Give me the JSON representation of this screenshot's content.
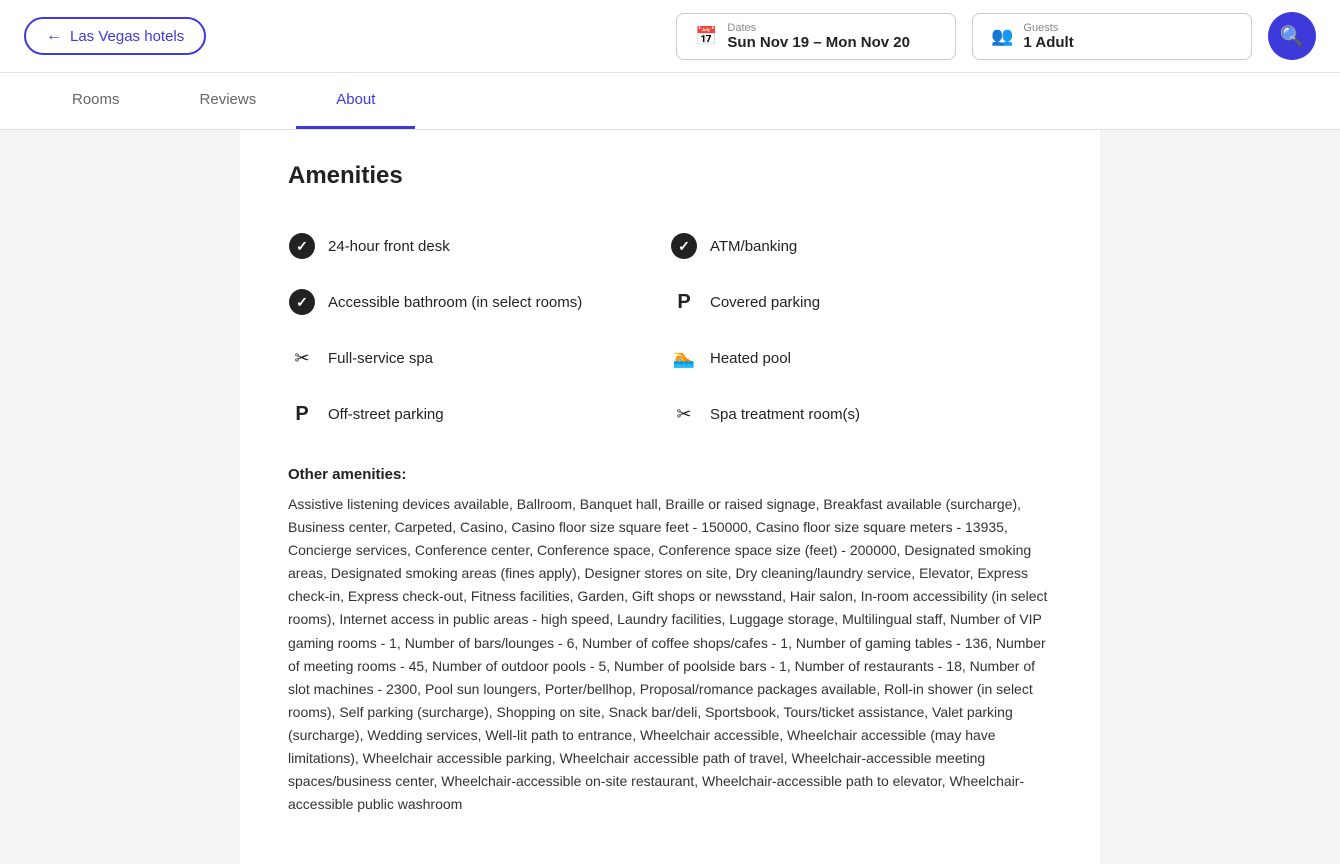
{
  "header": {
    "back_label": "Las Vegas hotels",
    "dates_label": "Dates",
    "dates_value": "Sun Nov 19 – Mon Nov 20",
    "guests_label": "Guests",
    "guests_value": "1 Adult"
  },
  "tabs": [
    {
      "id": "rooms",
      "label": "Rooms",
      "active": false
    },
    {
      "id": "reviews",
      "label": "Reviews",
      "active": false
    },
    {
      "id": "about",
      "label": "About",
      "active": true
    }
  ],
  "amenities": {
    "title": "Amenities",
    "items": [
      {
        "id": "24h-desk",
        "icon": "check",
        "label": "24-hour front desk"
      },
      {
        "id": "atm",
        "icon": "check",
        "label": "ATM/banking"
      },
      {
        "id": "accessible-bathroom",
        "icon": "check",
        "label": "Accessible bathroom (in select rooms)"
      },
      {
        "id": "covered-parking",
        "icon": "parking",
        "label": "Covered parking"
      },
      {
        "id": "spa",
        "icon": "spa",
        "label": "Full-service spa"
      },
      {
        "id": "heated-pool",
        "icon": "pool",
        "label": "Heated pool"
      },
      {
        "id": "off-street-parking",
        "icon": "parking",
        "label": "Off-street parking"
      },
      {
        "id": "spa-treatment",
        "icon": "spa",
        "label": "Spa treatment room(s)"
      }
    ],
    "other_title": "Other amenities:",
    "other_text": "Assistive listening devices available, Ballroom, Banquet hall, Braille or raised signage, Breakfast available (surcharge), Business center, Carpeted, Casino, Casino floor size square feet - 150000, Casino floor size square meters - 13935, Concierge services, Conference center, Conference space, Conference space size (feet) - 200000, Designated smoking areas, Designated smoking areas (fines apply), Designer stores on site, Dry cleaning/laundry service, Elevator, Express check-in, Express check-out, Fitness facilities, Garden, Gift shops or newsstand, Hair salon, In-room accessibility (in select rooms), Internet access in public areas - high speed, Laundry facilities, Luggage storage, Multilingual staff, Number of VIP gaming rooms - 1, Number of bars/lounges - 6, Number of coffee shops/cafes - 1, Number of gaming tables - 136, Number of meeting rooms - 45, Number of outdoor pools - 5, Number of poolside bars - 1, Number of restaurants - 18, Number of slot machines - 2300, Pool sun loungers, Porter/bellhop, Proposal/romance packages available, Roll-in shower (in select rooms), Self parking (surcharge), Shopping on site, Snack bar/deli, Sportsbook, Tours/ticket assistance, Valet parking (surcharge), Wedding services, Well-lit path to entrance, Wheelchair accessible, Wheelchair accessible (may have limitations), Wheelchair accessible parking, Wheelchair accessible path of travel, Wheelchair-accessible meeting spaces/business center, Wheelchair-accessible on-site restaurant, Wheelchair-accessible path to elevator, Wheelchair-accessible public washroom"
  }
}
